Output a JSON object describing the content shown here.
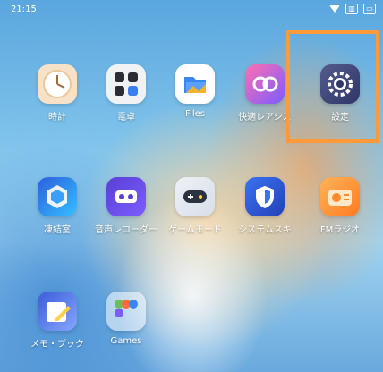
{
  "status_bar": {
    "time": "21:15",
    "battery_icon": "battery-icon",
    "wifi_icon": "wifi-icon",
    "signal_icon": "signal-icon"
  },
  "apps": [
    {
      "label": "時計",
      "icon": "clock-icon"
    },
    {
      "label": "電卓",
      "icon": "calculator-icon"
    },
    {
      "label": "Files",
      "icon": "files-icon"
    },
    {
      "label": "快適レアシス",
      "icon": "assistant-icon"
    },
    {
      "label": "設定",
      "icon": "settings-gear-icon"
    },
    {
      "label": "凍結室",
      "icon": "freezer-icon"
    },
    {
      "label": "音声レコーダー",
      "icon": "recorder-icon"
    },
    {
      "label": "ゲームモード",
      "icon": "gamepad-icon"
    },
    {
      "label": "システムスキ",
      "icon": "shield-icon"
    },
    {
      "label": "FMラジオ",
      "icon": "radio-icon"
    },
    {
      "label": "メモ・ブック",
      "icon": "notes-icon"
    },
    {
      "label": "Games",
      "icon": "games-folder-icon"
    }
  ],
  "highlight": {
    "color": "#ff9a3a"
  }
}
